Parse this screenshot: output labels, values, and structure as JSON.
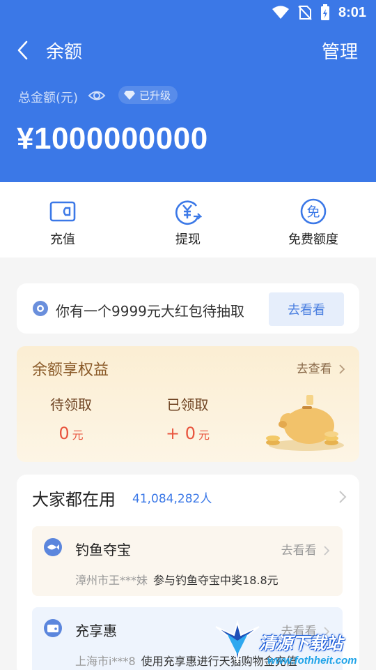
{
  "status_bar": {
    "time": "8:01"
  },
  "header": {
    "title": "余额",
    "manage_label": "管理",
    "total_label": "总金额(元)",
    "upgrade_badge": "已升级",
    "balance": "¥1000000000"
  },
  "actions": [
    {
      "label": "充值",
      "icon": "wallet-icon"
    },
    {
      "label": "提现",
      "icon": "yuan-withdraw-icon"
    },
    {
      "label": "免费额度",
      "icon": "free-quota-icon"
    }
  ],
  "red_packet": {
    "text": "你有一个9999元大红包待抽取",
    "button_label": "去看看"
  },
  "benefits": {
    "title": "余额享权益",
    "more_label": "去查看",
    "pending_label": "待领取",
    "pending_value": "0",
    "pending_unit": "元",
    "received_label": "已领取",
    "received_value": "+ 0",
    "received_unit": "元"
  },
  "popular": {
    "title": "大家都在用",
    "count": "41,084,282人",
    "items": [
      {
        "title": "钓鱼夺宝",
        "more": "去看看",
        "user": "漳州市王***妹",
        "desc": "参与钓鱼夺宝中奖18.8元"
      },
      {
        "title": "充享惠",
        "more": "去看看",
        "user": "上海市i***8",
        "desc": "使用充享惠进行天猫购物金充值"
      }
    ]
  },
  "watermark": {
    "text": "清源下载站",
    "url": "www.fothheit.com"
  },
  "colors": {
    "primary": "#3b78e7",
    "accent_red": "#e8553e",
    "gold": "#8a5a28"
  }
}
